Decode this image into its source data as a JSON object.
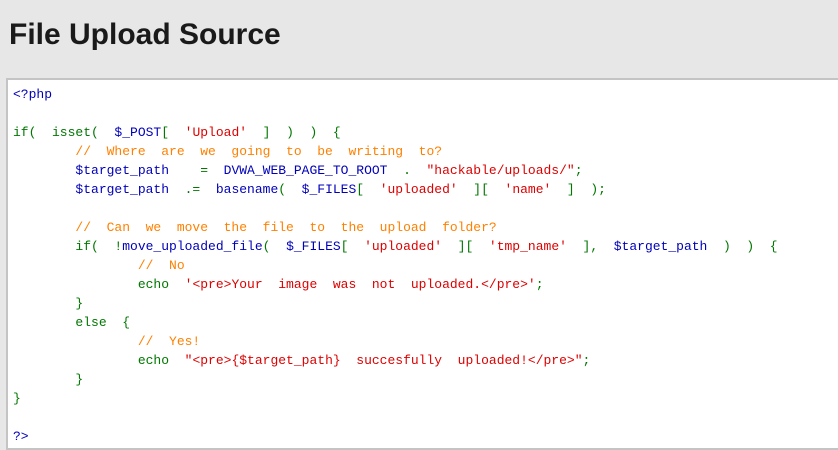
{
  "page": {
    "title": "File Upload Source"
  },
  "source": {
    "lines": [
      [
        {
          "t": "tag",
          "v": "<?php"
        }
      ],
      [
        {
          "t": "default",
          "v": ""
        }
      ],
      [
        {
          "t": "default",
          "v": "if(  isset(  "
        },
        {
          "t": "var",
          "v": "$_POST"
        },
        {
          "t": "default",
          "v": "[  "
        },
        {
          "t": "str",
          "v": "'Upload'"
        },
        {
          "t": "default",
          "v": "  ]  )  )  {"
        }
      ],
      [
        {
          "t": "com",
          "v": "        //  Where  are  we  going  to  be  writing  to?"
        }
      ],
      [
        {
          "t": "var",
          "v": "        $target_path"
        },
        {
          "t": "default",
          "v": "    =  "
        },
        {
          "t": "var",
          "v": "DVWA_WEB_PAGE_TO_ROOT"
        },
        {
          "t": "default",
          "v": "  .  "
        },
        {
          "t": "str",
          "v": "\"hackable/uploads/\""
        },
        {
          "t": "default",
          "v": ";"
        }
      ],
      [
        {
          "t": "var",
          "v": "        $target_path"
        },
        {
          "t": "default",
          "v": "  .=  "
        },
        {
          "t": "var",
          "v": "basename"
        },
        {
          "t": "default",
          "v": "(  "
        },
        {
          "t": "var",
          "v": "$_FILES"
        },
        {
          "t": "default",
          "v": "[  "
        },
        {
          "t": "str",
          "v": "'uploaded'"
        },
        {
          "t": "default",
          "v": "  ][  "
        },
        {
          "t": "str",
          "v": "'name'"
        },
        {
          "t": "default",
          "v": "  ]  );"
        }
      ],
      [
        {
          "t": "default",
          "v": ""
        }
      ],
      [
        {
          "t": "com",
          "v": "        //  Can  we  move  the  file  to  the  upload  folder?"
        }
      ],
      [
        {
          "t": "default",
          "v": "        if(  !"
        },
        {
          "t": "var",
          "v": "move_uploaded_file"
        },
        {
          "t": "default",
          "v": "(  "
        },
        {
          "t": "var",
          "v": "$_FILES"
        },
        {
          "t": "default",
          "v": "[  "
        },
        {
          "t": "str",
          "v": "'uploaded'"
        },
        {
          "t": "default",
          "v": "  ][  "
        },
        {
          "t": "str",
          "v": "'tmp_name'"
        },
        {
          "t": "default",
          "v": "  ],  "
        },
        {
          "t": "var",
          "v": "$target_path"
        },
        {
          "t": "default",
          "v": "  )  )  {"
        }
      ],
      [
        {
          "t": "com",
          "v": "                //  No"
        }
      ],
      [
        {
          "t": "default",
          "v": "                echo  "
        },
        {
          "t": "str",
          "v": "'<pre>Your  image  was  not  uploaded.</pre>'"
        },
        {
          "t": "default",
          "v": ";"
        }
      ],
      [
        {
          "t": "default",
          "v": "        }"
        }
      ],
      [
        {
          "t": "default",
          "v": "        else  {"
        }
      ],
      [
        {
          "t": "com",
          "v": "                //  Yes!"
        }
      ],
      [
        {
          "t": "default",
          "v": "                echo  "
        },
        {
          "t": "str",
          "v": "\"<pre>{$target_path}  succesfully  uploaded!</pre>\""
        },
        {
          "t": "default",
          "v": ";"
        }
      ],
      [
        {
          "t": "default",
          "v": "        }"
        }
      ],
      [
        {
          "t": "default",
          "v": "}"
        }
      ],
      [
        {
          "t": "default",
          "v": ""
        }
      ],
      [
        {
          "t": "tag",
          "v": "?>"
        }
      ]
    ]
  },
  "colors": {
    "background": "#e7e7e7",
    "code_background": "#ffffff",
    "tag": "#0000bb",
    "keyword": "#007700",
    "string": "#dd0000",
    "comment": "#ff8000"
  }
}
